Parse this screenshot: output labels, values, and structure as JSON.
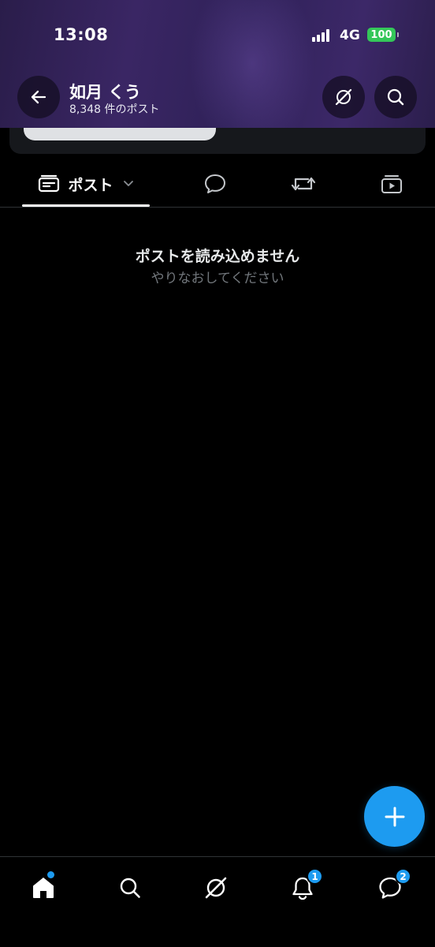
{
  "status_bar": {
    "time": "13:08",
    "network": "4G",
    "battery": "100"
  },
  "header": {
    "profile_name": "如月 くう",
    "post_count": "8,348 件のポスト",
    "icons": [
      "back-arrow-icon",
      "grok-icon",
      "search-icon"
    ]
  },
  "tabs": {
    "posts_label": "ポスト",
    "items": [
      "posts",
      "replies",
      "reposts",
      "media"
    ]
  },
  "empty_state": {
    "title": "ポストを読み込めません",
    "subtitle": "やりなおしてください"
  },
  "bottom_nav": {
    "items": [
      "home",
      "search",
      "grok",
      "notifications",
      "messages"
    ],
    "notifications_badge": "1",
    "messages_badge": "2"
  },
  "colors": {
    "accent": "#1d9bf0",
    "battery": "#34c759",
    "background": "#000000",
    "divider": "#2f3336",
    "secondary_text": "#71767b"
  }
}
